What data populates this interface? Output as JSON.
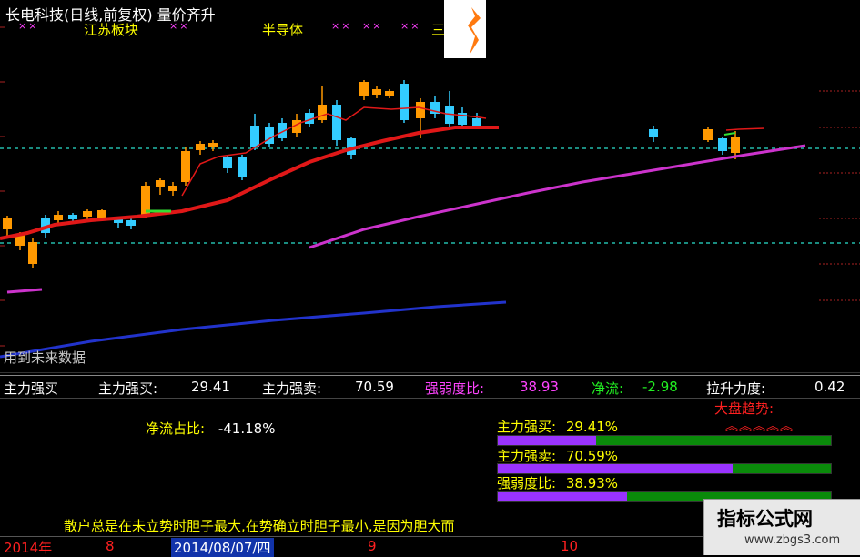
{
  "header": {
    "title": "长电科技(日线,前复权) 量价齐升",
    "sectors": [
      "江苏板块",
      "半导体",
      "三"
    ],
    "markers": [
      "××",
      "××",
      "××",
      "××",
      "××"
    ]
  },
  "chart": {
    "future_note": "用到未来数据",
    "colors": {
      "ma_short": "#e01818",
      "ma_mid": "#cc33cc",
      "ma_long": "#2233cc",
      "bull": "#ff9900",
      "bear": "#33ccff",
      "dash": "#22bbaa"
    }
  },
  "indicator_bar": {
    "name": "主力强买",
    "buy_label": "主力强买:",
    "buy_value": "29.41",
    "sell_label": "主力强卖:",
    "sell_value": "70.59",
    "ratio_label": "强弱度比:",
    "ratio_value": "38.93",
    "net_label": "净流:",
    "net_value": "-2.98",
    "pull_label": "拉升力度:",
    "pull_value": "0.42"
  },
  "panel": {
    "net_ratio_label": "净流占比:",
    "net_ratio_value": "-41.18%",
    "buy_label": "主力强买:",
    "buy_value": "29.41%",
    "buy_fill": 0.2941,
    "sell_label": "主力强卖:",
    "sell_value": "70.59%",
    "sell_fill": 0.7059,
    "ratio_label": "强弱度比:",
    "ratio_value": "38.93%",
    "ratio_fill": 0.3893,
    "big_trend_label": "大盘趋势:",
    "chevrons": "︽︽︽︽︽"
  },
  "slogan": "散户总是在未立势时胆子最大,在势确立时胆子最小,是因为胆大而",
  "watermark": {
    "title": "指标公式网",
    "url": "www.zbgs3.com"
  },
  "timebar": {
    "year": "2014年",
    "t1": "8",
    "current_date": "2014/08/07/四",
    "t2": "9",
    "t3": "10"
  }
}
